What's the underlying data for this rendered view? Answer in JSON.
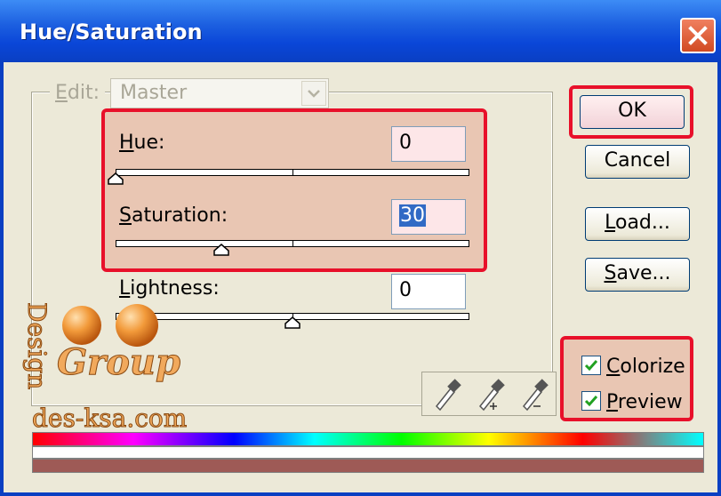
{
  "window": {
    "title": "Hue/Saturation"
  },
  "edit": {
    "label": "Edit:",
    "value": "Master"
  },
  "hue": {
    "label": "Hue:",
    "value": "0",
    "level": 0.0
  },
  "saturation": {
    "label": "Saturation:",
    "value": "30",
    "level": 0.3
  },
  "lightness": {
    "label": "Lightness:",
    "value": "0",
    "level": 0.5
  },
  "buttons": {
    "ok": "OK",
    "cancel": "Cancel",
    "load": "Load...",
    "save": "Save..."
  },
  "checkboxes": {
    "colorize": "Colorize",
    "preview": "Preview"
  },
  "watermark": {
    "line1": "Design",
    "line2": "Group",
    "url": "des-ksa.com"
  },
  "colors": {
    "highlight": "#e8102a",
    "titlebar": "#0a46d8",
    "result_bar": "#9e5a56"
  }
}
